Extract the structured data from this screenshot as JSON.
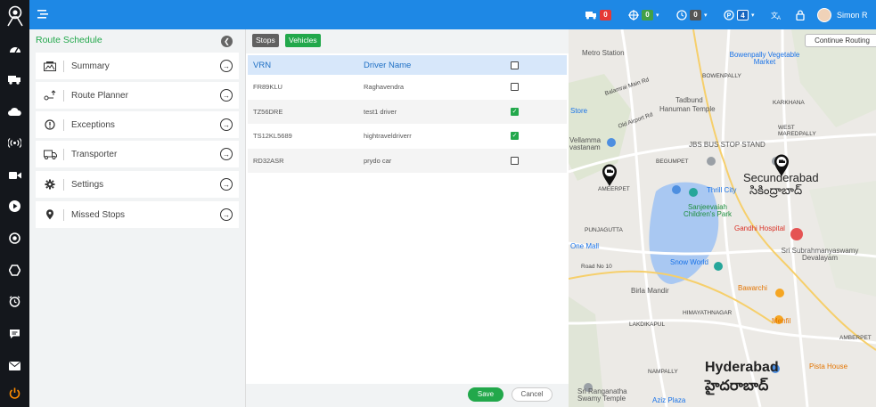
{
  "topbar": {
    "alerts_count": "0",
    "online_count": "0",
    "idle_count": "0",
    "parked_count": "4",
    "user_name": "Simon R"
  },
  "route_schedule": {
    "title": "Route Schedule",
    "items": [
      {
        "label": "Summary",
        "icon": "summary-icon"
      },
      {
        "label": "Route Planner",
        "icon": "route-planner-icon"
      },
      {
        "label": "Exceptions",
        "icon": "exceptions-icon"
      },
      {
        "label": "Transporter",
        "icon": "transporter-icon"
      },
      {
        "label": "Settings",
        "icon": "settings-icon"
      },
      {
        "label": "Missed Stops",
        "icon": "location-pin-icon"
      }
    ]
  },
  "vehicles_panel": {
    "tabs": {
      "stops": "Stops",
      "vehicles": "Vehicles"
    },
    "columns": {
      "vrn": "VRN",
      "driver": "Driver Name"
    },
    "select_all_checked": false,
    "rows": [
      {
        "vrn": "FR89KLU",
        "driver": "Raghavendra",
        "checked": false
      },
      {
        "vrn": "TZ56DRE",
        "driver": "test1 driver",
        "checked": true
      },
      {
        "vrn": "TS12KL5689",
        "driver": "hightraveldriverr",
        "checked": true
      },
      {
        "vrn": "RD32ASR",
        "driver": "prydo car",
        "checked": false
      }
    ],
    "save_label": "Save",
    "cancel_label": "Cancel"
  },
  "map": {
    "continue_label": "Continue Routing",
    "labels": {
      "metro": "Metro Station",
      "bowenpally": "BOWENPALLY",
      "vegetable_market": "Bowenpally Vegetable Market",
      "balamrai": "Balamrai Main Rd",
      "tadbund": "Tadbund",
      "hanuman_temple": "Hanuman Temple",
      "karkhana": "KARKHANA",
      "store": "Store",
      "old_airport": "Old Airport Rd",
      "west_marredpally": "WEST MAREDPALLY",
      "vellamma": "Vellamma vastanam",
      "jbs": "JBS BUS STOP STAND",
      "begumpet": "BEGUMPET",
      "secunderabad": "Secunderabad",
      "secunderabad_te": "సికింద్రాబాద్",
      "ameerpet": "AMEERPET",
      "thrill_city": "Thrill City",
      "sanjeevaiah": "Sanjeevaiah Children's Park",
      "gandhi_hospital": "Gandhi Hospital",
      "punjagutta": "PUNJAGUTTA",
      "one_mall": "One Mall",
      "sri_subrahmanya": "Sri Subrahmanyaswamy Devalayam",
      "snow_world": "Snow World",
      "road_no_10": "Road No 10",
      "birla_mandir": "Birla Mandir",
      "bawarchi": "Bawarchi",
      "mehfil": "Mehfil",
      "himayatnagar": "HIMAYATHNAGAR",
      "lakdikapul": "LAKDIKAPUL",
      "ameerpet2": "AMBERPET",
      "nampally": "NAMPALLY",
      "hyderabad": "Hyderabad",
      "hyderabad_te": "హైదరాబాద్",
      "pista_house": "Pista House",
      "ranganatha": "Sri Ranganatha Swamy Temple",
      "aziz_plaza": "Aziz Plaza"
    }
  },
  "colors": {
    "accent_green": "#22a84b",
    "topbar_blue": "#1e88e5",
    "rail_dark": "#14171c"
  }
}
